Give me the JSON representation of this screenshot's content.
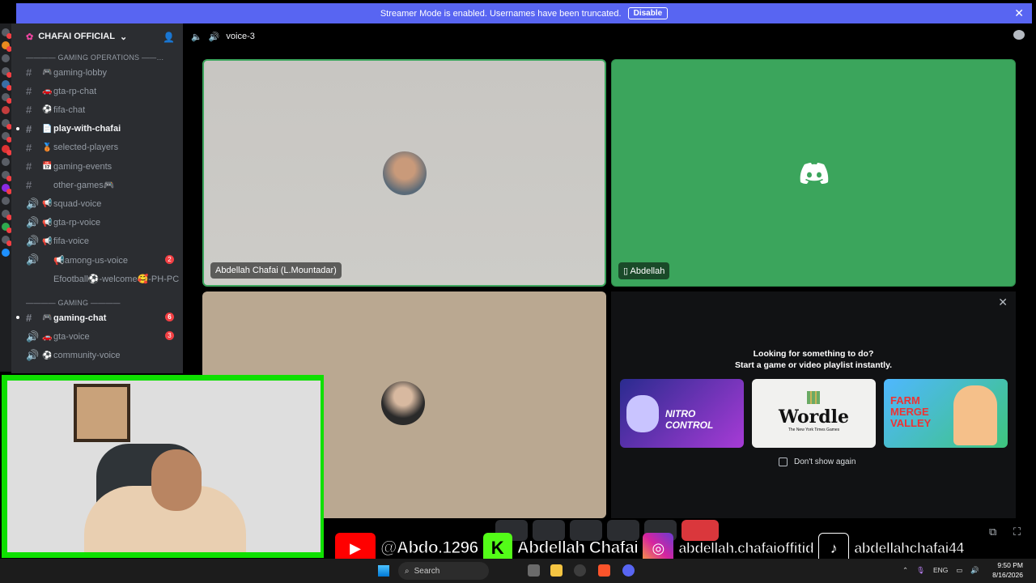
{
  "banner": {
    "text": "Streamer Mode is enabled. Usernames have been truncated.",
    "disable_label": "Disable",
    "close": "✕"
  },
  "server": {
    "name": "CHAFAI OFFICIAL",
    "chevron": "⌄"
  },
  "sidebar": {
    "categories": [
      {
        "label": "———— GAMING OPERATIONS ——…"
      },
      {
        "label": "———— GAMING ————"
      }
    ],
    "channels": [
      {
        "type": "#",
        "emoji": "🎮",
        "name": "gaming-lobby"
      },
      {
        "type": "#",
        "emoji": "🚗",
        "name": "gta-rp-chat"
      },
      {
        "type": "#",
        "emoji": "⚽",
        "name": "fifa-chat"
      },
      {
        "type": "#",
        "emoji": "📄",
        "name": "play-with-chafai",
        "active": true
      },
      {
        "type": "#",
        "emoji": "🥉",
        "name": "selected-players"
      },
      {
        "type": "#",
        "emoji": "📅",
        "name": "gaming-events"
      },
      {
        "type": "#",
        "emoji": "",
        "name": "other-games🎮"
      },
      {
        "type": "🔊",
        "emoji": "📢",
        "name": "squad-voice"
      },
      {
        "type": "🔊",
        "emoji": "📢",
        "name": "gta-rp-voice"
      },
      {
        "type": "🔊",
        "emoji": "📢",
        "name": "fifa-voice"
      },
      {
        "type": "🔊",
        "emoji": "",
        "name": "📢among-us-voice",
        "badge": "2"
      },
      {
        "type": "",
        "emoji": "",
        "name": "Efootball⚽-welcome🥰-PH-PC"
      }
    ],
    "channels2": [
      {
        "type": "#",
        "emoji": "🎮",
        "name": "gaming-chat",
        "active": true,
        "badge": "6"
      },
      {
        "type": "🔊",
        "emoji": "🚗",
        "name": "gta-voice",
        "badge": "3"
      },
      {
        "type": "🔊",
        "emoji": "⚽",
        "name": "community-voice"
      }
    ]
  },
  "topbar": {
    "channel": "voice-3"
  },
  "tiles": [
    {
      "name": "Abdellah Chafai (L.Mountadar)"
    },
    {
      "name": "Abdellah"
    }
  ],
  "activity": {
    "line1": "Looking for something to do?",
    "line2": "Start a game or video playlist instantly.",
    "cards": [
      "NITRO CONTROL",
      "Wordle",
      "FARM MERGE VALLEY"
    ],
    "wordle_sub": "The New York Times Games",
    "dont_show": "Don't show again",
    "close": "✕"
  },
  "overlay": {
    "youtube": "@Abdo.1296",
    "kick": "Abdellah Chafai",
    "instagram": "abdellah.chafaioffitid",
    "tiktok": "abdellahchafai44"
  },
  "taskbar": {
    "search": "Search",
    "lang": "ENG",
    "time": "9:50 PM",
    "date": "8/16/2026"
  },
  "colors": {
    "accent": "#5865f2",
    "green": "#3ba55c",
    "red": "#da373c",
    "webcam_frame": "#0fe000"
  }
}
